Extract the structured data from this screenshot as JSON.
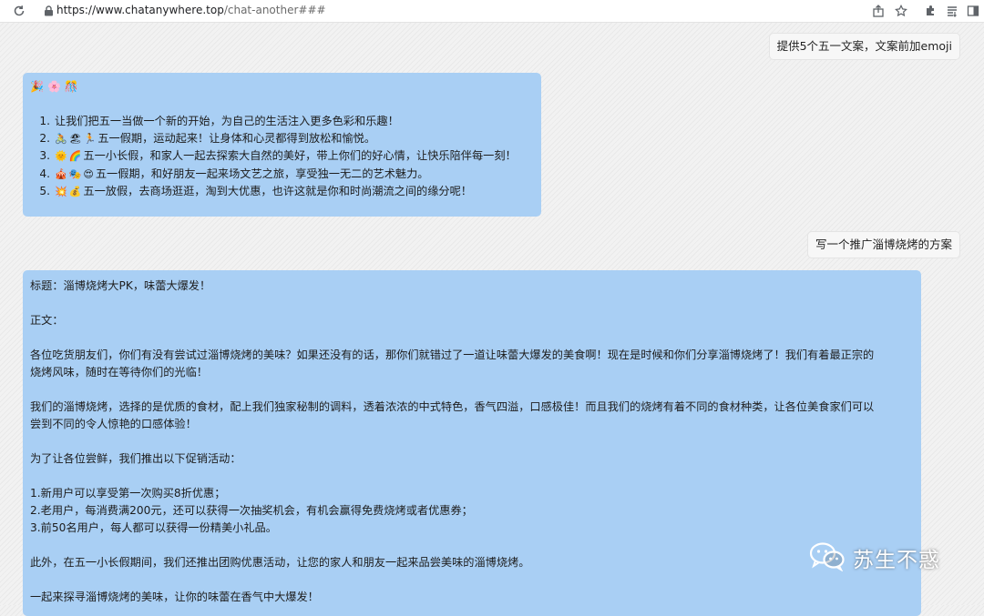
{
  "browser": {
    "url_host": "https://www.chatanywhere.top",
    "url_path": "/chat-another###"
  },
  "conversation": {
    "msg1_user": "提供5个五一文案，文案前加emoji",
    "msg1_reply": {
      "header_emojis": [
        "🎉",
        "🌸",
        "🎊"
      ],
      "items": [
        {
          "num": "1.",
          "emojis": [],
          "text": "让我们把五一当做一个新的开始，为自己的生活注入更多色彩和乐趣！"
        },
        {
          "num": "2.",
          "emojis": [
            "🚴",
            "🏖",
            "🏃"
          ],
          "text": "五一假期，运动起来！让身体和心灵都得到放松和愉悦。"
        },
        {
          "num": "3.",
          "emojis": [
            "🌞",
            "🌈"
          ],
          "text": "五一小长假，和家人一起去探索大自然的美好，带上你们的好心情，让快乐陪伴每一刻！"
        },
        {
          "num": "4.",
          "emojis": [
            "🎪",
            "🎭",
            "😍"
          ],
          "text": "五一假期，和好朋友一起来场文艺之旅，享受独一无二的艺术魅力。"
        },
        {
          "num": "5.",
          "emojis": [
            "💥",
            "💰"
          ],
          "text": "五一放假，去商场逛逛，淘到大优惠，也许这就是你和时尚潮流之间的缘分呢！"
        }
      ]
    },
    "msg2_user": "写一个推广淄博烧烤的方案",
    "msg2_reply": {
      "p1": "标题：淄博烧烤大PK，味蕾大爆发！",
      "p2": "正文：",
      "p3a": "各位吃货朋友们，你们有没有尝试过淄博烧烤的美味？如果还没有的话，那你们就错过了一道让味蕾大爆发的美食啊！现在是时候和你们分享淄博烧烤了！我们有着最正宗的",
      "p3b": "烧烤风味，随时在等待你们的光临！",
      "p4a": "我们的淄博烧烤，选择的是优质的食材，配上我们独家秘制的调料，透着浓浓的中式特色，香气四溢，口感极佳！而且我们的烧烤有着不同的食材种类，让各位美食家们可以",
      "p4b": "尝到不同的令人惊艳的口感体验！",
      "p5": "为了让各位尝鲜，我们推出以下促销活动：",
      "p6a": "1.新用户可以享受第一次购买8折优惠；",
      "p6b": "2.老用户，每消费满200元，还可以获得一次抽奖机会，有机会赢得免费烧烤或者优惠券；",
      "p6c": "3.前50名用户，每人都可以获得一份精美小礼品。",
      "p7": "此外，在五一小长假期间，我们还推出团购优惠活动，让您的家人和朋友一起来品尝美味的淄博烧烤。",
      "p8": "一起来探寻淄博烧烤的美味，让你的味蕾在香气中大爆发！"
    }
  },
  "watermark": {
    "text": "苏生不惑"
  },
  "colors": {
    "bot_bubble": "#a9cff4",
    "user_bubble": "#f7f7f7"
  }
}
